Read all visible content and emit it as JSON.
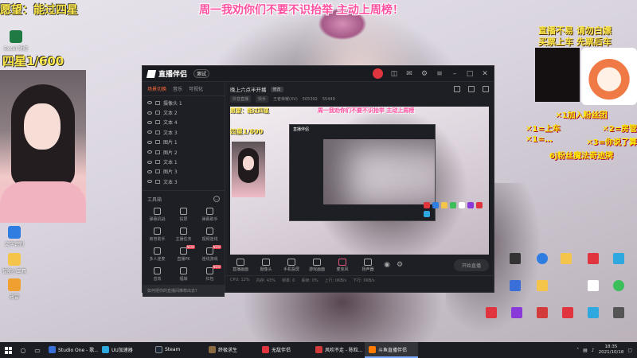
{
  "overlay": {
    "wish_text": "愿望：能过四星",
    "stars_text": "四星1/600",
    "banner_text": "周一我劝你们不要不识抬举 主动上周榜！",
    "tip_line_1": "直播不易 请勿白嫖",
    "tip_line_2": "买票上车 先票后车",
    "gifts": [
      {
        "left": "✕1加入粉丝团",
        "right": ""
      },
      {
        "left": "✕1=上车",
        "right": "✕2=房管"
      },
      {
        "left": "✕1=…",
        "right": "✕3=你说了算"
      },
      {
        "left": "6j粉丝魔法奇迹牌",
        "right": ""
      }
    ]
  },
  "desktop_icons_left": [
    {
      "label": "Excel 财经",
      "color": "#1f7a43"
    },
    {
      "label": "文字识别",
      "color": "#2f7de1"
    },
    {
      "label": "智能小工具",
      "color": "#f4c54a"
    },
    {
      "label": "迅雷",
      "color": "#f0a030"
    }
  ],
  "app": {
    "name": "直播伴侣",
    "version_badge": "测试",
    "scene_tabs": [
      "场景切换",
      "音乐",
      "可视化"
    ],
    "sources": [
      "摄像头 1",
      "文本 2",
      "文本 4",
      "文本 3",
      "图片 1",
      "图片 2",
      "文本 1",
      "图片 3",
      "文本 3"
    ],
    "tools_header": "工具箱",
    "tools_more": "…",
    "tools": [
      {
        "label": "弹幕机战",
        "new": ""
      },
      {
        "label": "投屏",
        "new": ""
      },
      {
        "label": "弹幕助手",
        "new": ""
      },
      {
        "label": "房管助手",
        "new": ""
      },
      {
        "label": "主播任务",
        "new": ""
      },
      {
        "label": "视频连线",
        "new": ""
      },
      {
        "label": "多人连麦",
        "new": ""
      },
      {
        "label": "直播PK",
        "new": "NEW"
      },
      {
        "label": "连线游戏",
        "new": "NEW"
      },
      {
        "label": "音效",
        "new": ""
      },
      {
        "label": "福袋",
        "new": ""
      },
      {
        "label": "红包",
        "new": "NEW"
      }
    ],
    "notice": "如何把你的直播间推荐出去？",
    "stream_title": "晚上六点半开播",
    "edit_label": "修改",
    "stats": [
      "抖音直播",
      "快手",
      "王者荣耀(XV)",
      "505392",
      "55449"
    ],
    "preview": {
      "wish": "愿望：能过四星",
      "banner": "周一我劝你们不要不识抬举 主动上周榜",
      "stars": "四星1/600",
      "nested_title": "直播伴侣"
    },
    "controls": [
      "直播画面",
      "摄像头",
      "手机投屏",
      "游戏画面",
      "麦克风",
      "扬声器"
    ],
    "go_live": "开始直播",
    "status": [
      "CPU: 12%",
      "内存: 43%",
      "帧率: 0",
      "丢帧: 0%",
      "上行: 0KB/s",
      "下行: 0KB/s"
    ]
  },
  "taskbar": {
    "items": [
      {
        "label": "Studio One - 歌...",
        "color": "#3a6fd8",
        "active": false
      },
      {
        "label": "UU加速器",
        "color": "#2fa8e0",
        "active": false
      },
      {
        "label": "Steam",
        "color": "#1b2838",
        "active": false
      },
      {
        "label": "终极求生",
        "color": "#8a6a40",
        "active": false
      },
      {
        "label": "无敌伴侣",
        "color": "#e0343e",
        "active": false
      },
      {
        "label": "风吹不走 - 陈粒...",
        "color": "#d33a3a",
        "active": false
      },
      {
        "label": "斗鱼直播伴侣",
        "color": "#ff7a00",
        "active": true
      }
    ],
    "time": "18:35",
    "date": "2021/10/18"
  }
}
